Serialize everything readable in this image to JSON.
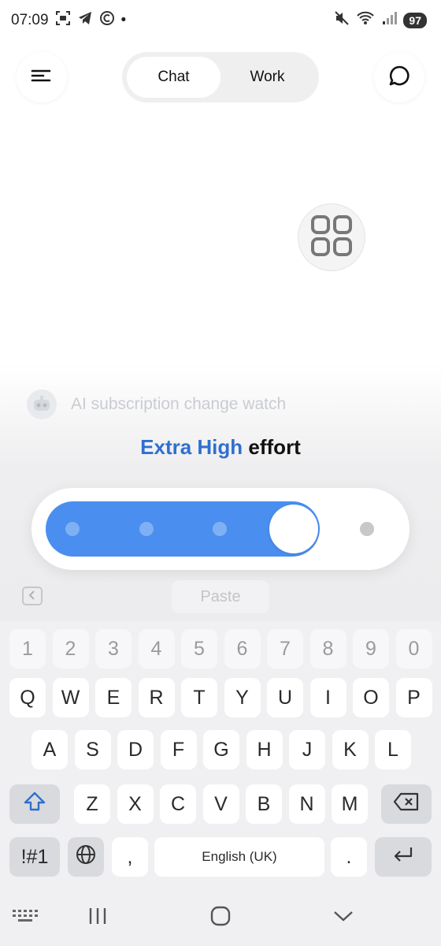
{
  "status": {
    "time": "07:09",
    "battery": "97",
    "dot": "•"
  },
  "tabs": [
    {
      "label": "Chat",
      "active": true
    },
    {
      "label": "Work",
      "active": false
    }
  ],
  "suggestion": "AI subscription change watch",
  "effort": {
    "level": "Extra High",
    "word": "effort",
    "steps": 5,
    "selected_step": 4
  },
  "clipboard": {
    "paste_label": "Paste"
  },
  "keyboard": {
    "numbers": [
      "1",
      "2",
      "3",
      "4",
      "5",
      "6",
      "7",
      "8",
      "9",
      "0"
    ],
    "row1": [
      "Q",
      "W",
      "E",
      "R",
      "T",
      "Y",
      "U",
      "I",
      "O",
      "P"
    ],
    "row2": [
      "A",
      "S",
      "D",
      "F",
      "G",
      "H",
      "J",
      "K",
      "L"
    ],
    "row3": [
      "Z",
      "X",
      "C",
      "V",
      "B",
      "N",
      "M"
    ],
    "symbols_label": "!#1",
    "comma": ",",
    "space_label": "English (UK)",
    "period": "."
  },
  "colors": {
    "accent": "#4a8ef0",
    "effort_text": "#2f6fcf"
  }
}
